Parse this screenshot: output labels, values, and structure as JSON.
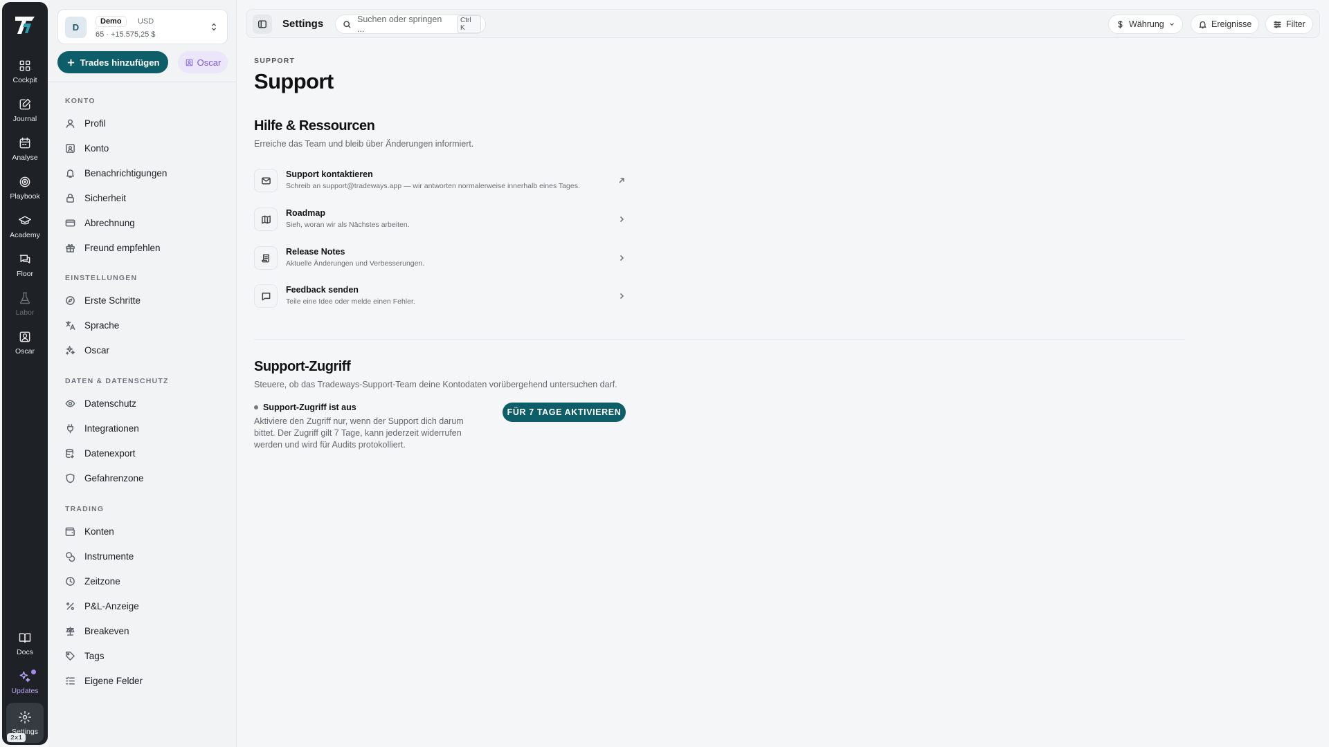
{
  "rail": {
    "items": [
      {
        "label": "Cockpit"
      },
      {
        "label": "Journal"
      },
      {
        "label": "Analyse"
      },
      {
        "label": "Playbook"
      },
      {
        "label": "Academy"
      },
      {
        "label": "Floor"
      },
      {
        "label": "Labor"
      },
      {
        "label": "Oscar"
      }
    ],
    "bottom": [
      {
        "label": "Docs"
      },
      {
        "label": "Updates"
      },
      {
        "label": "Settings"
      }
    ],
    "badge": "2x1"
  },
  "account": {
    "initial": "D",
    "name": "Demo",
    "currency": "USD",
    "summary": "65 · +15.575,25 $"
  },
  "sidebar": {
    "add_trades": "Trades hinzufügen",
    "oscar": "Oscar",
    "sections": {
      "konto": {
        "title": "KONTO",
        "items": [
          "Profil",
          "Konto",
          "Benachrichtigungen",
          "Sicherheit",
          "Abrechnung",
          "Freund empfehlen"
        ]
      },
      "einstellungen": {
        "title": "EINSTELLUNGEN",
        "items": [
          "Erste Schritte",
          "Sprache",
          "Oscar"
        ]
      },
      "daten": {
        "title": "DATEN & DATENSCHUTZ",
        "items": [
          "Datenschutz",
          "Integrationen",
          "Datenexport",
          "Gefahrenzone"
        ]
      },
      "trading": {
        "title": "TRADING",
        "items": [
          "Konten",
          "Instrumente",
          "Zeitzone",
          "P&L-Anzeige",
          "Breakeven",
          "Tags",
          "Eigene Felder"
        ]
      }
    }
  },
  "topbar": {
    "title": "Settings",
    "search_placeholder": "Suchen oder springen ...",
    "search_shortcut": "Ctrl K",
    "currency_label": "Währung",
    "events_label": "Ereignisse",
    "filter_label": "Filter"
  },
  "main": {
    "eyebrow": "SUPPORT",
    "title": "Support",
    "resources": {
      "title": "Hilfe & Ressourcen",
      "description": "Erreiche das Team und bleib über Änderungen informiert.",
      "items": [
        {
          "title": "Support kontaktieren",
          "subtitle": "Schreib an support@tradeways.app — wir antworten normalerweise innerhalb eines Tages."
        },
        {
          "title": "Roadmap",
          "subtitle": "Sieh, woran wir als Nächstes arbeiten."
        },
        {
          "title": "Release Notes",
          "subtitle": "Aktuelle Änderungen und Verbesserungen."
        },
        {
          "title": "Feedback senden",
          "subtitle": "Teile eine Idee oder melde einen Fehler."
        }
      ]
    },
    "access": {
      "title": "Support-Zugriff",
      "description": "Steuere, ob das Tradeways-Support-Team deine Kontodaten vorübergehend untersuchen darf.",
      "status": "Support-Zugriff ist aus",
      "status_description": "Aktiviere den Zugriff nur, wenn der Support dich darum bittet. Der Zugriff gilt 7 Tage, kann jederzeit widerrufen werden und wird für Audits protokolliert.",
      "activate_button": "FÜR 7 TAGE AKTIVIEREN"
    }
  },
  "colors": {
    "accent": "#0e5e6a",
    "rail_bg": "#1e2226",
    "oscar_purple": "#7a55d8"
  }
}
